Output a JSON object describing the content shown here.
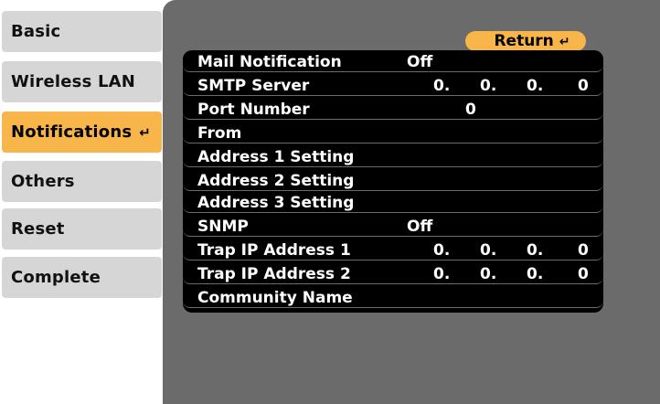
{
  "tabs": [
    {
      "label": "Basic"
    },
    {
      "label": "Wireless LAN"
    },
    {
      "label": "Notifications",
      "icon": "enter-icon"
    },
    {
      "label": "Others"
    },
    {
      "label": "Reset"
    },
    {
      "label": "Complete"
    }
  ],
  "selected_tab": "Notifications",
  "return_button": {
    "label": "Return",
    "icon": "enter-icon"
  },
  "settings": {
    "mail_notification": {
      "label": "Mail Notification",
      "value": "Off"
    },
    "smtp_server": {
      "label": "SMTP Server",
      "octets": [
        "0.",
        "0.",
        "0.",
        "0"
      ]
    },
    "port_number": {
      "label": "Port Number",
      "value": "0"
    },
    "from": {
      "label": "From"
    },
    "address1": {
      "label": "Address 1 Setting"
    },
    "address2": {
      "label": "Address 2 Setting"
    },
    "address3": {
      "label": "Address 3 Setting"
    },
    "snmp": {
      "label": "SNMP",
      "value": "Off"
    },
    "trap_ip1": {
      "label": "Trap IP Address 1",
      "octets": [
        "0.",
        "0.",
        "0.",
        "0"
      ]
    },
    "trap_ip2": {
      "label": "Trap IP Address 2",
      "octets": [
        "0.",
        "0.",
        "0.",
        "0"
      ]
    },
    "community_name": {
      "label": "Community Name"
    }
  },
  "colors": {
    "tab_bg": "#d6d6d6",
    "selected_bg": "#f7b54a",
    "panel_bg": "#6b6b6b",
    "list_bg": "#000000",
    "text_light": "#ffffff"
  },
  "icons": {
    "enter": "↵"
  }
}
